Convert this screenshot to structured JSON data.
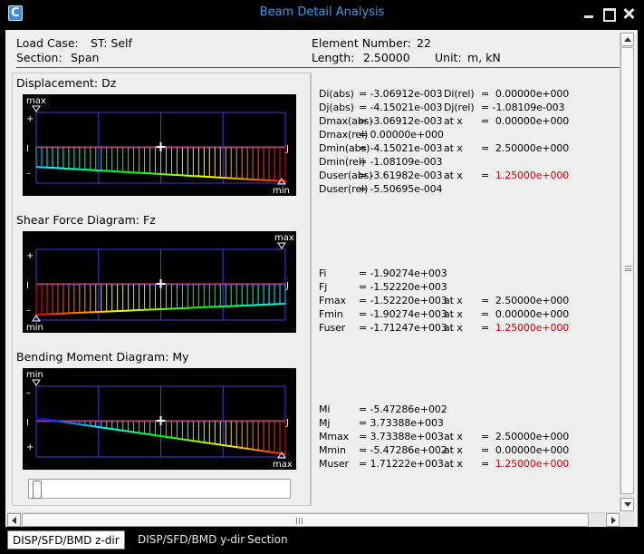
{
  "window": {
    "title": "Beam Detail Analysis",
    "app_icon_letter": "C"
  },
  "header": {
    "load_case_label": "Load Case:",
    "load_case_value": "ST: Self",
    "section_label": "Section:",
    "section_value": "Span",
    "element_number_label": "Element Number:",
    "element_number_value": "22",
    "length_label": "Length:",
    "length_value": "2.50000",
    "unit_label": "Unit:",
    "unit_value": "m,  kN"
  },
  "diagrams": {
    "displacement": {
      "title": "Displacement: Dz",
      "top_label": "max",
      "bottom_label": "min",
      "left_labels": [
        "+",
        "I",
        "–"
      ],
      "right_label": "J"
    },
    "shear": {
      "title": "Shear Force Diagram: Fz",
      "top_label": "max",
      "bottom_label": "min",
      "left_labels": [
        "+",
        "I",
        "–"
      ],
      "right_label": "J"
    },
    "moment": {
      "title": "Bending Moment Diagram: My",
      "top_label": "min",
      "bottom_label": "max",
      "left_labels": [
        "–",
        "I",
        "+"
      ],
      "right_label": "J"
    }
  },
  "slider": {
    "position": 0.0
  },
  "results": {
    "displacement": [
      {
        "a": "Di(abs)",
        "b": "= -3.06912e-003",
        "c": "Di(rel)",
        "d": "=  0.00000e+000",
        "red": false
      },
      {
        "a": "Dj(abs)",
        "b": "= -4.15021e-003",
        "c": "Dj(rel)",
        "d": "= -1.08109e-003",
        "red": false
      },
      {
        "a": "Dmax(abs)",
        "b": "= -3.06912e-003",
        "c": "at x",
        "d": "=  0.00000e+000",
        "red": false
      },
      {
        "a": "Dmax(rel)",
        "b": "=  0.00000e+000",
        "c": "",
        "d": "",
        "red": false
      },
      {
        "a": "Dmin(abs)",
        "b": "= -4.15021e-003",
        "c": "at x",
        "d": "=  2.50000e+000",
        "red": false
      },
      {
        "a": "Dmin(rel)",
        "b": "= -1.08109e-003",
        "c": "",
        "d": "",
        "red": false
      },
      {
        "a": "Duser(abs)",
        "b": "= -3.61982e-003",
        "c": "at x",
        "d": "=  ",
        "dred": "1.25000e+000",
        "red": true
      },
      {
        "a": "Duser(rel)",
        "b": "= -5.50695e-004",
        "c": "",
        "d": "",
        "red": false
      }
    ],
    "shear": [
      {
        "a": "Fi",
        "b": "= -1.90274e+003",
        "c": "",
        "d": "",
        "red": false
      },
      {
        "a": "Fj",
        "b": "= -1.52220e+003",
        "c": "",
        "d": "",
        "red": false
      },
      {
        "a": "Fmax",
        "b": "= -1.52220e+003",
        "c": "at x",
        "d": "=  2.50000e+000",
        "red": false
      },
      {
        "a": "Fmin",
        "b": "= -1.90274e+003",
        "c": "at x",
        "d": "=  0.00000e+000",
        "red": false
      },
      {
        "a": "Fuser",
        "b": "= -1.71247e+003",
        "c": "at x",
        "d": "=  ",
        "dred": "1.25000e+000",
        "red": true
      }
    ],
    "moment": [
      {
        "a": "Mi",
        "b": "= -5.47286e+002",
        "c": "",
        "d": "",
        "red": false
      },
      {
        "a": "Mj",
        "b": "=  3.73388e+003",
        "c": "",
        "d": "",
        "red": false
      },
      {
        "a": "Mmax",
        "b": "=  3.73388e+003",
        "c": "at x",
        "d": "=  2.50000e+000",
        "red": false
      },
      {
        "a": "Mmin",
        "b": "= -5.47286e+002",
        "c": "at x",
        "d": "=  0.00000e+000",
        "red": false
      },
      {
        "a": "Muser",
        "b": "=  1.71222e+003",
        "c": "at x",
        "d": "=  ",
        "dred": "1.25000e+000",
        "red": true
      }
    ]
  },
  "tabs": [
    {
      "label": "DISP/SFD/BMD z-dir",
      "active": true
    },
    {
      "label": "DISP/SFD/BMD y-dir",
      "active": false
    },
    {
      "label": "Section",
      "active": false
    }
  ],
  "colors": {
    "title_text": "#3c9be6",
    "user_value": "#e00000",
    "plot_grid": "#3f3fd0",
    "hatch": "#d03a3a"
  }
}
